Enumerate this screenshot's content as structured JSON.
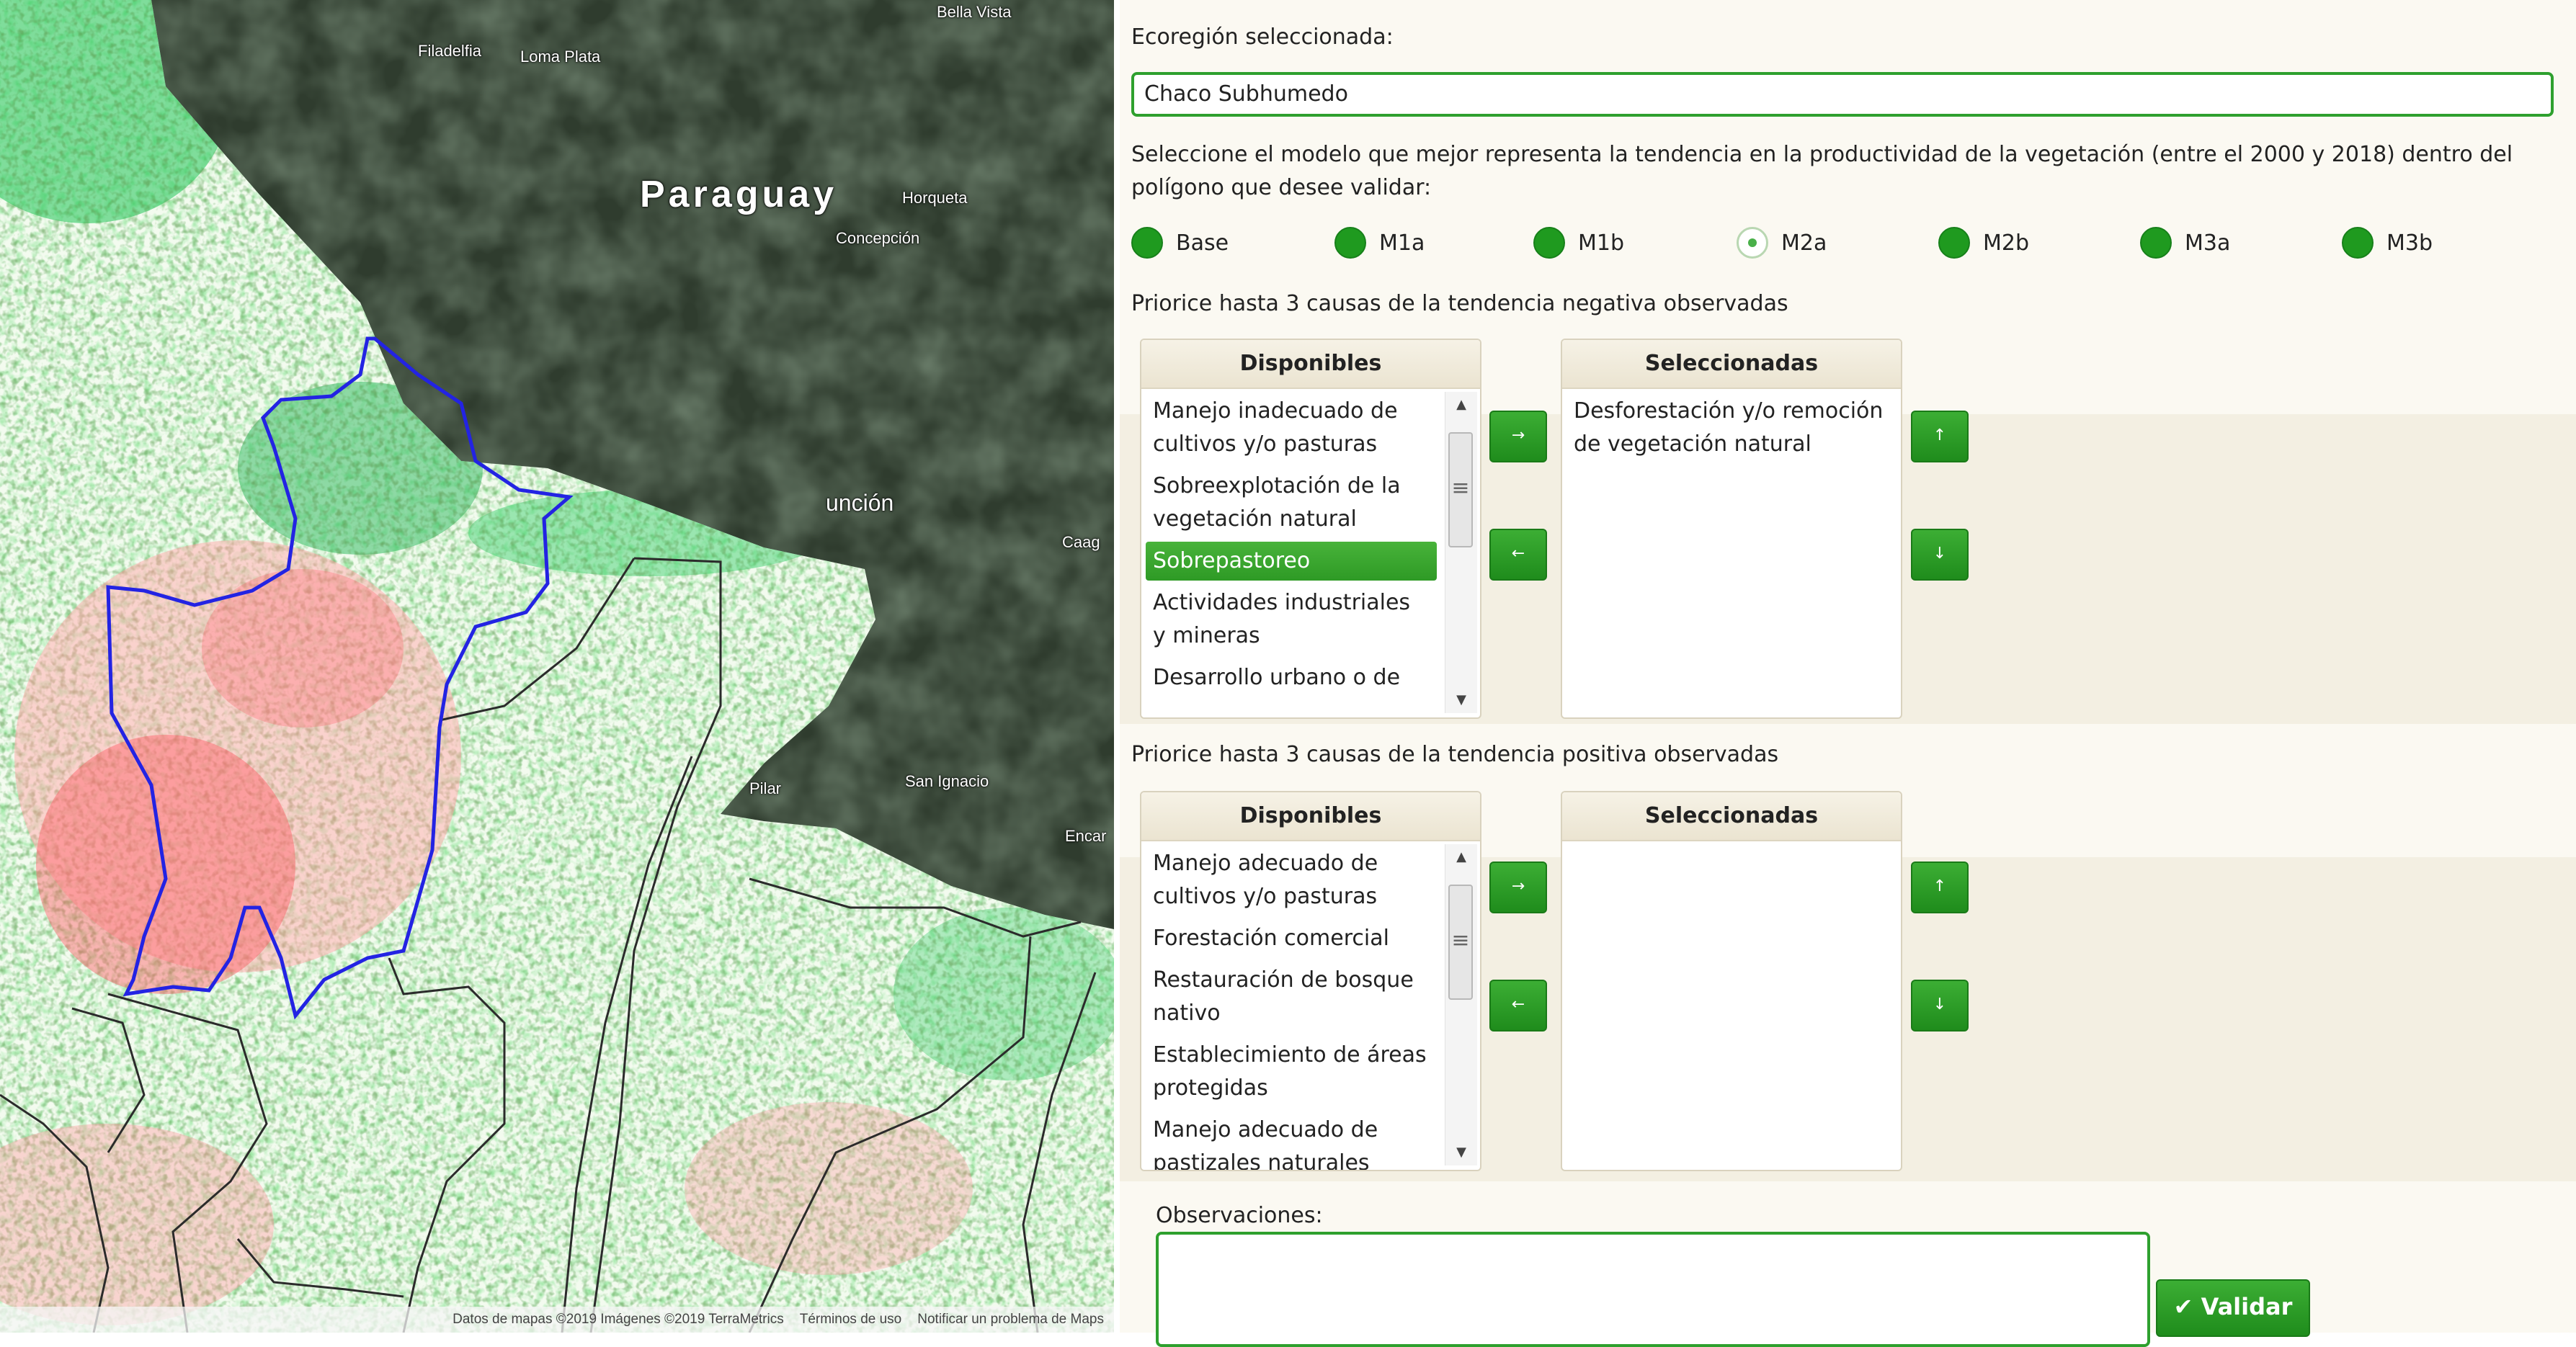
{
  "map": {
    "labels": {
      "country": "Paraguay",
      "bella_vista": "Bella Vista",
      "filadelfia": "Filadelfia",
      "loma_plata": "Loma Plata",
      "horqueta": "Horqueta",
      "concepcion": "Concepción",
      "asuncion": "unción",
      "caaguazu": "Caag",
      "pilar": "Pilar",
      "san_ignacio": "San Ignacio",
      "encarnacion": "Encar"
    },
    "footer": {
      "data": "Datos de mapas ©2019 Imágenes ©2019 TerraMetrics",
      "terms": "Términos de uso",
      "report": "Notificar un problema de Maps"
    },
    "colors": {
      "decline": "#e8303a",
      "increase": "#1fd35c",
      "polygon": "#2020e0"
    }
  },
  "panel": {
    "ecoregion_label": "Ecoregión seleccionada:",
    "ecoregion_value": "Chaco Subhumedo",
    "model_prompt": "Seleccione el modelo que mejor representa la tendencia en la productividad de la vegetación (entre el 2000 y 2018) dentro del polígono que desee validar:",
    "models": [
      {
        "label": "Base",
        "selected": false
      },
      {
        "label": "M1a",
        "selected": false
      },
      {
        "label": "M1b",
        "selected": false
      },
      {
        "label": "M2a",
        "selected": true
      },
      {
        "label": "M2b",
        "selected": false
      },
      {
        "label": "M3a",
        "selected": false
      },
      {
        "label": "M3b",
        "selected": false
      }
    ],
    "negative": {
      "prompt": "Priorice hasta 3 causas de la tendencia negativa observadas",
      "available_header": "Disponibles",
      "selected_header": "Seleccionadas",
      "available": [
        "Manejo inadecuado de cultivos y/o pasturas",
        "Sobreexplotación de la vegetación natural",
        "Sobrepastoreo",
        "Actividades industriales y mineras",
        "Desarrollo urbano o de"
      ],
      "highlighted": "Sobrepastoreo",
      "selected": [
        "Desforestación y/o remoción de vegetación natural"
      ]
    },
    "positive": {
      "prompt": "Priorice hasta 3 causas de la tendencia positiva observadas",
      "available_header": "Disponibles",
      "selected_header": "Seleccionadas",
      "available": [
        "Manejo adecuado de cultivos y/o pasturas",
        "Forestación comercial",
        "Restauración de bosque nativo",
        "Establecimiento de áreas protegidas",
        "Manejo adecuado de pastizales naturales"
      ],
      "selected": []
    },
    "observations_label": "Observaciones:",
    "validate_label": "✔ Validar",
    "arrows": {
      "right": "→",
      "left": "←",
      "up": "↑",
      "down": "↓"
    },
    "accent": "#2ea02e"
  }
}
